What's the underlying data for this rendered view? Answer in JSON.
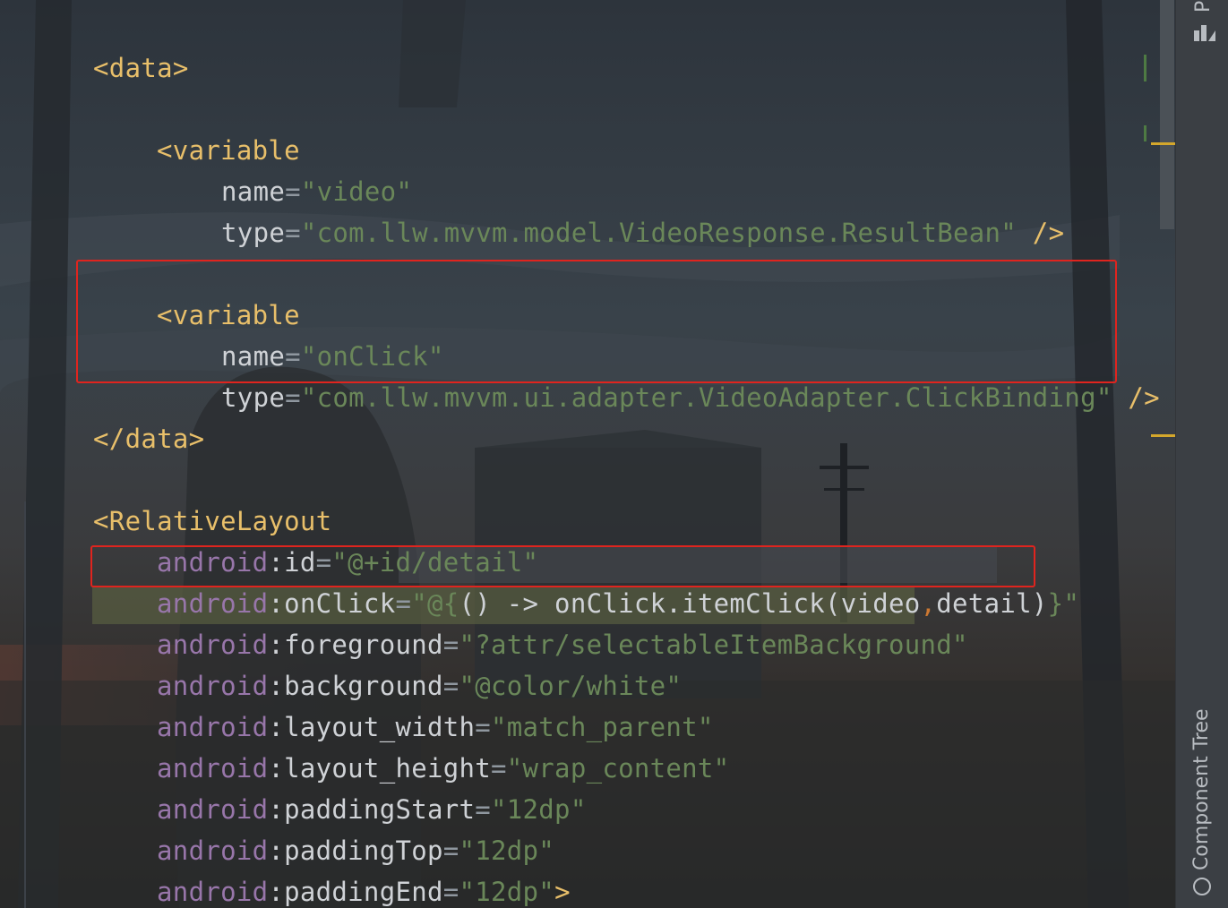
{
  "editor": {
    "lines": [
      {
        "tokens": [
          "<data>"
        ]
      },
      {
        "tokens": [
          "<variable"
        ]
      },
      {
        "tokens": [
          "name",
          "=",
          "\"video\""
        ]
      },
      {
        "tokens": [
          "type",
          "=",
          "\"com.llw.mvvm.model.VideoResponse.ResultBean\"",
          " />"
        ]
      },
      {
        "tokens": [
          "<variable"
        ]
      },
      {
        "tokens": [
          "name",
          "=",
          "\"onClick\""
        ]
      },
      {
        "tokens": [
          "type",
          "=",
          "\"com.llw.mvvm.ui.adapter.VideoAdapter.ClickBinding\"",
          " />"
        ]
      },
      {
        "tokens": [
          "</data>"
        ]
      },
      {
        "tokens": [
          "<RelativeLayout"
        ]
      },
      {
        "tokens": [
          "android",
          ":id",
          "=",
          "\"@+id/detail\""
        ]
      },
      {
        "tokens": [
          "android",
          ":onClick",
          "=",
          "\"@{",
          "() -> onClick.itemClick(video",
          ",",
          "detail)",
          "}\""
        ]
      },
      {
        "tokens": [
          "android",
          ":foreground",
          "=",
          "\"?attr/selectableItemBackground\""
        ]
      },
      {
        "tokens": [
          "android",
          ":background",
          "=",
          "\"@color/white\""
        ]
      },
      {
        "tokens": [
          "android",
          ":layout_width",
          "=",
          "\"match_parent\""
        ]
      },
      {
        "tokens": [
          "android",
          ":layout_height",
          "=",
          "\"wrap_content\""
        ]
      },
      {
        "tokens": [
          "android",
          ":paddingStart",
          "=",
          "\"12dp\""
        ]
      },
      {
        "tokens": [
          "android",
          ":paddingTop",
          "=",
          "\"12dp\""
        ]
      },
      {
        "tokens": [
          "android",
          ":paddingEnd",
          "=",
          "\"12dp\"",
          ">"
        ]
      }
    ]
  },
  "right_panel": {
    "top_tab_label": "P",
    "bottom_tab_label": "Component Tree"
  },
  "colors": {
    "tag": "#e8bf6a",
    "attribute": "#cfd2d6",
    "namespace": "#9876aa",
    "string": "#6a8759",
    "highlight_box": "#e0241e",
    "change_marker_yellow": "#d4a72c",
    "change_marker_green": "#4e7a43"
  }
}
